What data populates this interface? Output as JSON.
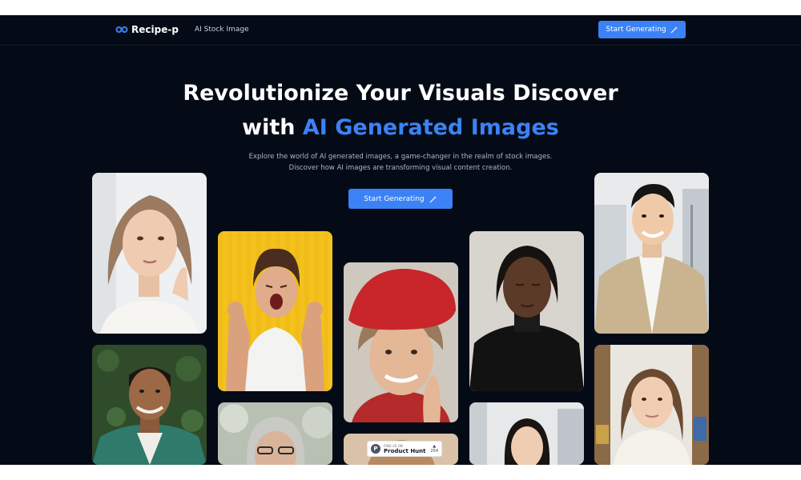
{
  "nav": {
    "brand": "Recipe-p",
    "link": "AI Stock Image",
    "cta": "Start Generating"
  },
  "hero": {
    "title_line1": "Revolutionize Your Visuals Discover",
    "title_line2_prefix": "with ",
    "title_line2_accent": "AI Generated Images",
    "subtitle_line1": "Explore the world of AI generated images, a game-changer in the realm of stock images.",
    "subtitle_line2": "Discover how AI images are transforming visual content creation.",
    "cta": "Start Generating"
  },
  "badge": {
    "small": "FIND US ON",
    "name": "Product Hunt",
    "votes": "254",
    "icon": "P"
  },
  "colors": {
    "background": "#050b16",
    "accent": "#3b82f6"
  }
}
